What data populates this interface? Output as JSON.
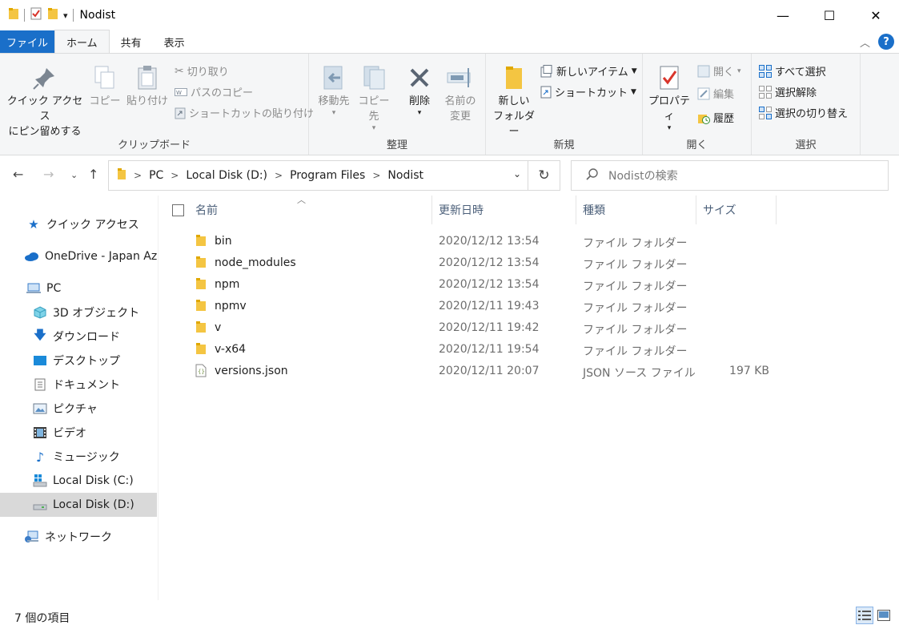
{
  "window": {
    "title": "Nodist",
    "controls": {
      "minimize": "—",
      "maximize": "☐",
      "close": "✕"
    }
  },
  "quick_access_toolbar": {
    "dropdown": "▾"
  },
  "ribbon_tabs": [
    "ファイル",
    "ホーム",
    "共有",
    "表示"
  ],
  "ribbon": {
    "clipboard": {
      "label": "クリップボード",
      "pin_line1": "クイック アクセス",
      "pin_line2": "にピン留めする",
      "copy": "コピー",
      "paste": "貼り付け",
      "cut": "切り取り",
      "copy_path": "パスのコピー",
      "paste_shortcut": "ショートカットの貼り付け"
    },
    "organize": {
      "label": "整理",
      "move_to": "移動先",
      "copy_to": "コピー先",
      "delete": "削除",
      "rename_line1": "名前の",
      "rename_line2": "変更"
    },
    "new": {
      "label": "新規",
      "new_folder_line1": "新しい",
      "new_folder_line2": "フォルダー",
      "new_item": "新しいアイテム",
      "shortcut": "ショートカット"
    },
    "open": {
      "label": "開く",
      "properties": "プロパティ",
      "open": "開く",
      "edit": "編集",
      "history": "履歴"
    },
    "select": {
      "label": "選択",
      "select_all": "すべて選択",
      "select_none": "選択解除",
      "invert": "選択の切り替え"
    }
  },
  "address": {
    "crumbs": [
      "PC",
      "Local Disk (D:)",
      "Program Files",
      "Nodist"
    ],
    "refresh": "↻"
  },
  "search": {
    "placeholder": "Nodistの検索"
  },
  "nav": {
    "quick_access": "クイック アクセス",
    "onedrive": "OneDrive - Japan Azu",
    "pc": "PC",
    "objects3d": "3D オブジェクト",
    "downloads": "ダウンロード",
    "desktop": "デスクトップ",
    "documents": "ドキュメント",
    "pictures": "ピクチャ",
    "videos": "ビデオ",
    "music": "ミュージック",
    "disk_c": "Local Disk (C:)",
    "disk_d": "Local Disk (D:)",
    "network": "ネットワーク"
  },
  "columns": {
    "name": "名前",
    "date": "更新日時",
    "type": "種類",
    "size": "サイズ"
  },
  "files": [
    {
      "name": "bin",
      "date": "2020/12/12 13:54",
      "type": "ファイル フォルダー",
      "size": "",
      "icon": "folder-icon"
    },
    {
      "name": "node_modules",
      "date": "2020/12/12 13:54",
      "type": "ファイル フォルダー",
      "size": "",
      "icon": "folder-icon"
    },
    {
      "name": "npm",
      "date": "2020/12/12 13:54",
      "type": "ファイル フォルダー",
      "size": "",
      "icon": "folder-icon"
    },
    {
      "name": "npmv",
      "date": "2020/12/11 19:43",
      "type": "ファイル フォルダー",
      "size": "",
      "icon": "folder-icon"
    },
    {
      "name": "v",
      "date": "2020/12/11 19:42",
      "type": "ファイル フォルダー",
      "size": "",
      "icon": "folder-icon"
    },
    {
      "name": "v-x64",
      "date": "2020/12/11 19:54",
      "type": "ファイル フォルダー",
      "size": "",
      "icon": "folder-icon"
    },
    {
      "name": "versions.json",
      "date": "2020/12/11 20:07",
      "type": "JSON ソース ファイル",
      "size": "197 KB",
      "icon": "json-file-icon"
    }
  ],
  "status": {
    "item_count": "7 個の項目"
  },
  "colors": {
    "accent": "#1a6fc9",
    "folder": "#f4c542",
    "selected_nav": "#d9d9d9"
  }
}
